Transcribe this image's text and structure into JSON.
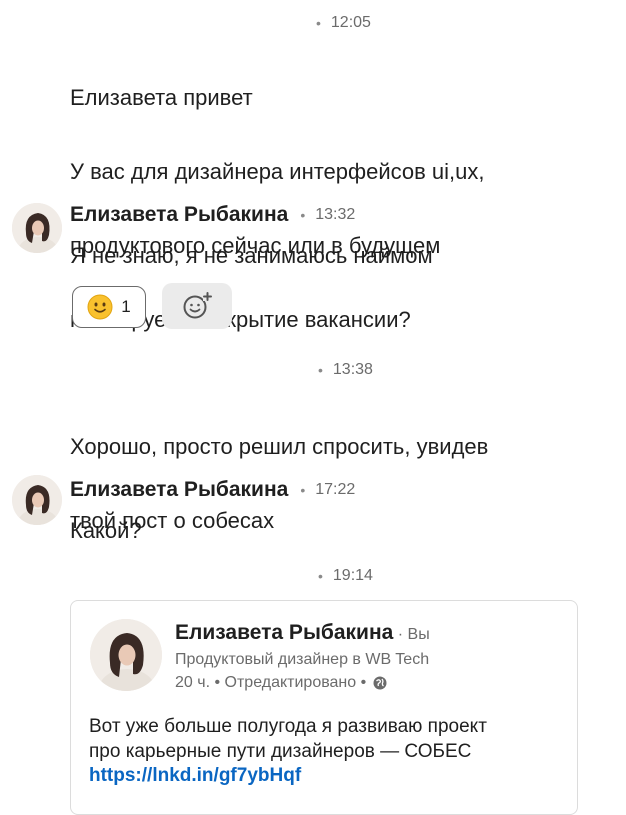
{
  "messages": [
    {
      "time": "12:05",
      "lines": [
        "Елизавета привет",
        "У вас для дизайнера интерфейсов ui,ux,",
        "продуктового сейчас или в будущем",
        "планируется открытие вакансии?"
      ]
    },
    {
      "sender": "Елизавета Рыбакина",
      "time": "13:32",
      "text": "Я не знаю, я не занимаюсь наймом",
      "reaction": {
        "emoji": "smiling-face-icon",
        "count": "1"
      }
    },
    {
      "time": "13:38",
      "lines": [
        "Хорошо, просто решил спросить, увидев",
        "твой пост о собесах"
      ]
    },
    {
      "sender": "Елизавета Рыбакина",
      "time": "17:22",
      "text": "Какой?"
    },
    {
      "time": "19:14",
      "shared_post": {
        "author": "Елизавета Рыбакина",
        "author_tag": "· Вы",
        "headline": "Продуктовый дизайнер в WB Tech",
        "meta": "20 ч. • Отредактировано •",
        "body_lines": [
          "Вот уже больше полугода я развиваю проект",
          "про карьерные пути дизайнеров — СОБЕС"
        ],
        "link": "https://lnkd.in/gf7ybHqf"
      }
    }
  ],
  "separator_dot": "•",
  "colors": {
    "link": "#0a66c2",
    "meta": "#6b6b6b",
    "text": "#1f1f1f"
  }
}
